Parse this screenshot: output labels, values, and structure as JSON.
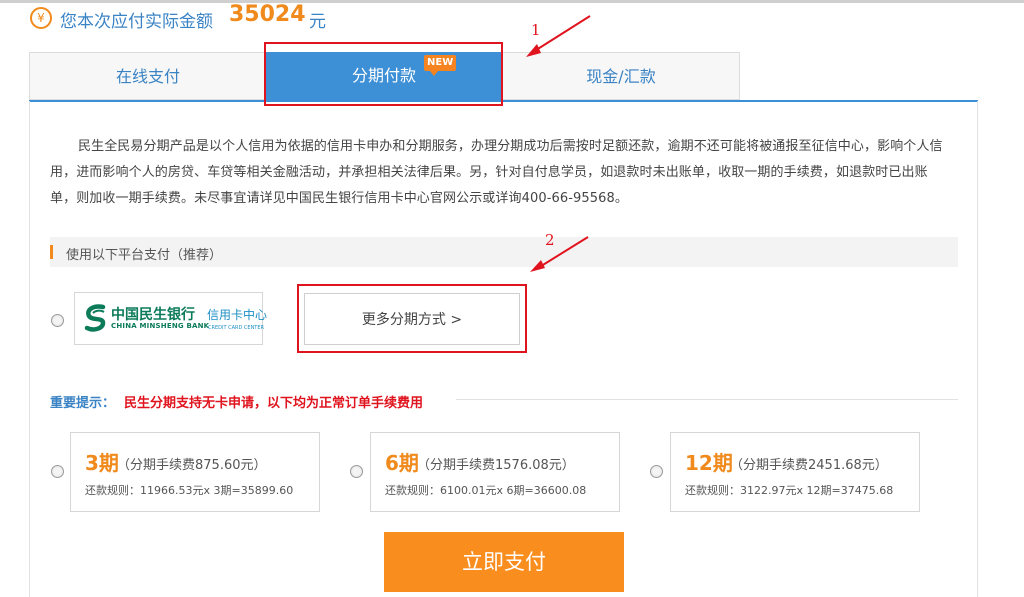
{
  "header": {
    "yen_symbol": "¥",
    "amount_label": "您本次应付实际金额",
    "amount_value": "35024",
    "amount_unit": "元"
  },
  "tabs": [
    {
      "label": "在线支付",
      "active": false
    },
    {
      "label": "分期付款",
      "active": true,
      "badge": "NEW"
    },
    {
      "label": "现金/汇款",
      "active": false
    }
  ],
  "description": "民生全民易分期产品是以个人信用为依据的信用卡申办和分期服务，办理分期成功后需按时足额还款，逾期不还可能将被通报至征信中心，影响个人信用，进而影响个人的房贷、车贷等相关金融活动，并承担相关法律后果。另，针对自付息学员，如退款时未出账单，收取一期的手续费，如退款时已出账单，则加收一期手续费。未尽事宜请详见中国民生银行信用卡中心官网公示或详询400-66-95568。",
  "platform": {
    "label": "使用以下平台支付（推荐）",
    "bank_name_cn": "中国民生银行",
    "bank_name_en": "CHINA MINSHENG BANK",
    "card_center_cn": "信用卡中心",
    "card_center_en": "CREDIT CARD CENTER",
    "more_button": "更多分期方式 >"
  },
  "notice": {
    "label": "重要提示：",
    "text": "民生分期支持无卡申请，以下均为正常订单手续费用"
  },
  "plans": [
    {
      "term": "3期",
      "fee": "（分期手续费875.60元）",
      "rule": "还款规则：11966.53元x 3期=35899.60"
    },
    {
      "term": "6期",
      "fee": "（分期手续费1576.08元）",
      "rule": "还款规则：6100.01元x 6期=36600.08"
    },
    {
      "term": "12期",
      "fee": "（分期手续费2451.68元）",
      "rule": "还款规则：3122.97元x 12期=37475.68"
    }
  ],
  "pay_button": "立即支付",
  "annotations": {
    "first": "1",
    "second": "2"
  },
  "colors": {
    "accent_blue": "#3d8fd6",
    "accent_orange": "#f98d1e",
    "highlight_red": "#e0141e",
    "bank_green": "#0b7b5a"
  }
}
